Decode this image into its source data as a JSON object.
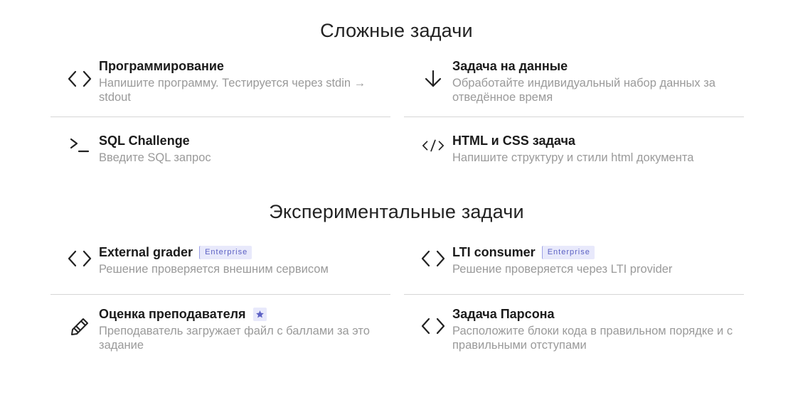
{
  "sections": [
    {
      "title": "Сложные задачи",
      "items": [
        {
          "title": "Программирование",
          "desc": "Напишите программу. Тестируется через stdin → stdout",
          "icon": "code-brackets-icon"
        },
        {
          "title": "Задача на данные",
          "desc": "Обработайте индивидуальный набор данных за отведённое время",
          "icon": "arrow-down-icon"
        },
        {
          "title": "SQL Challenge",
          "desc": "Введите SQL запрос",
          "icon": "terminal-prompt-icon"
        },
        {
          "title": "HTML и CSS задача",
          "desc": "Напишите структуру и стили html документа",
          "icon": "html-tag-icon"
        }
      ]
    },
    {
      "title": "Экспериментальные задачи",
      "items": [
        {
          "title": "External grader",
          "badge": "Enterprise",
          "desc": "Решение проверяется внешним сервисом",
          "icon": "code-brackets-icon"
        },
        {
          "title": "LTI consumer",
          "badge": "Enterprise",
          "desc": "Решение проверяется через LTI provider",
          "icon": "code-brackets-icon"
        },
        {
          "title": "Оценка преподавателя",
          "desc": "Преподаватель загружает файл с баллами за это задание",
          "icon": "pencil-icon",
          "badge_icon": "star-icon"
        },
        {
          "title": "Задача Парсона",
          "desc": "Расположите блоки кода в правильном порядке и с правильными отступами",
          "icon": "code-brackets-icon"
        }
      ]
    }
  ],
  "colors": {
    "badge_bg": "#e8e9fb",
    "badge_text": "#5d62c4",
    "star": "#5d62c4"
  }
}
